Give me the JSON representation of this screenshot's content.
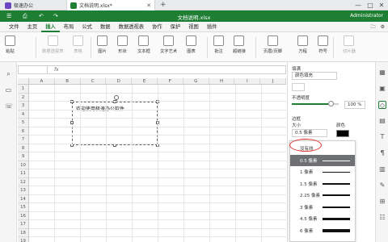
{
  "tabs": {
    "home": {
      "label": "极速办公"
    },
    "document": {
      "label": "文档说明.xlsx*"
    },
    "add": "+"
  },
  "window": {
    "minimize": "—",
    "maximize": "□",
    "close": "✕"
  },
  "titlebar": {
    "title": "文档说明.xlsx",
    "user": "Administrator"
  },
  "menu": {
    "items": [
      "文件",
      "主页",
      "插入",
      "布局",
      "公式",
      "数据",
      "数据透视表",
      "协作",
      "保护",
      "视图",
      "插件"
    ],
    "active_index": 2
  },
  "ribbon": {
    "items": [
      {
        "label": "粘贴",
        "enabled": true
      },
      {
        "label": "数据透视表",
        "enabled": false
      },
      {
        "label": "表格",
        "enabled": false
      },
      {
        "label": "图片",
        "enabled": true
      },
      {
        "label": "形状",
        "enabled": true
      },
      {
        "label": "文本框",
        "enabled": true
      },
      {
        "label": "文字艺术",
        "enabled": true
      },
      {
        "label": "图表",
        "enabled": true
      },
      {
        "label": "批注",
        "enabled": true
      },
      {
        "label": "超链接",
        "enabled": true
      },
      {
        "label": "页眉/页脚",
        "enabled": true
      },
      {
        "label": "方程",
        "enabled": true
      },
      {
        "label": "符号",
        "enabled": true
      },
      {
        "label": "切片器",
        "enabled": false
      }
    ]
  },
  "formula": {
    "fx": "fx"
  },
  "sheet": {
    "columns": [
      "A",
      "B",
      "C",
      "D",
      "E",
      "F",
      "G",
      "H",
      "I",
      "J"
    ],
    "rows": [
      "1",
      "2",
      "3",
      "4",
      "5",
      "6",
      "7",
      "8",
      "9",
      "10",
      "11",
      "12",
      "13",
      "14",
      "15",
      "16",
      "17",
      "18",
      "19"
    ],
    "textbox_text": "欢迎使用极速办公软件"
  },
  "panel": {
    "fill_label": "填满",
    "fill_value": "颜色填充",
    "opacity_label": "不透明度",
    "opacity_value": "100 %",
    "border_label": "边框",
    "size_label": "大小",
    "size_value": "0.5 像素",
    "color_label": "颜色",
    "color_value": "#000000"
  },
  "dropdown": {
    "items": [
      "没有线",
      "0.5 像素",
      "1 像素",
      "1.5 像素",
      "2.25 像素",
      "3 像素",
      "4.5 像素",
      "6 像素"
    ],
    "selected_index": 1
  },
  "colors": {
    "brand": "#1e7e34",
    "highlight": "#e0322b",
    "selected": "#6f7074"
  }
}
